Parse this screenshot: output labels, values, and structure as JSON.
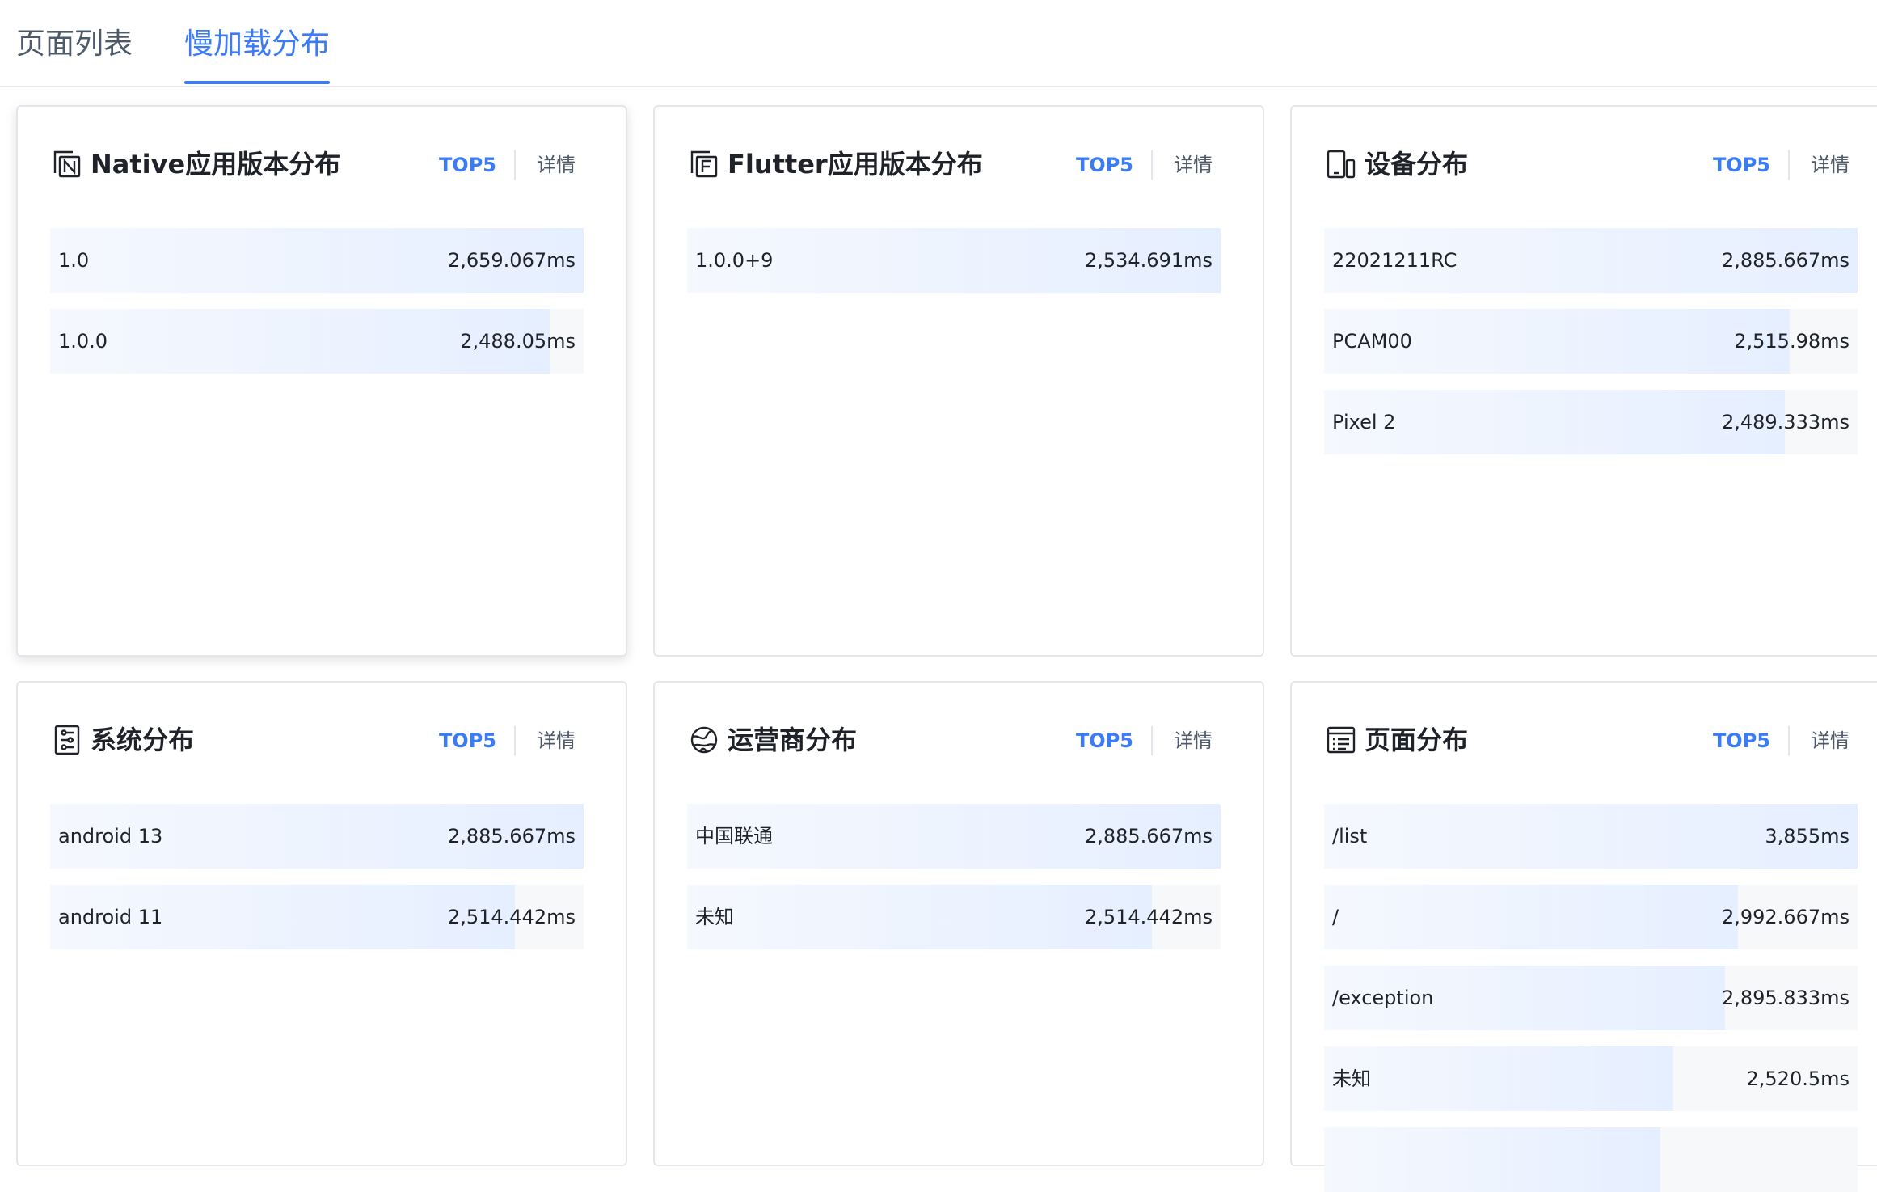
{
  "tabs": [
    {
      "label": "页面列表",
      "active": false
    },
    {
      "label": "慢加载分布",
      "active": true
    }
  ],
  "accent_color": "#3b7bf6",
  "cards": [
    {
      "title": "Native应用版本分布",
      "icon": "native-n-icon",
      "top5_label": "TOP5",
      "detail_label": "详情",
      "rows": [
        {
          "label": "1.0",
          "value": "2,659.067ms",
          "fill": 1.0
        },
        {
          "label": "1.0.0",
          "value": "2,488.05ms",
          "fill": 0.936
        }
      ]
    },
    {
      "title": "Flutter应用版本分布",
      "icon": "flutter-f-icon",
      "top5_label": "TOP5",
      "detail_label": "详情",
      "rows": [
        {
          "label": "1.0.0+9",
          "value": "2,534.691ms",
          "fill": 1.0
        }
      ]
    },
    {
      "title": "设备分布",
      "icon": "device-icon",
      "top5_label": "TOP5",
      "detail_label": "详情",
      "rows": [
        {
          "label": "22021211RC",
          "value": "2,885.667ms",
          "fill": 1.0
        },
        {
          "label": "PCAM00",
          "value": "2,515.98ms",
          "fill": 0.872
        },
        {
          "label": "Pixel 2",
          "value": "2,489.333ms",
          "fill": 0.863
        }
      ]
    },
    {
      "title": "系统分布",
      "icon": "system-settings-icon",
      "top5_label": "TOP5",
      "detail_label": "详情",
      "rows": [
        {
          "label": "android 13",
          "value": "2,885.667ms",
          "fill": 1.0
        },
        {
          "label": "android 11",
          "value": "2,514.442ms",
          "fill": 0.871
        }
      ]
    },
    {
      "title": "运营商分布",
      "icon": "carrier-globe-icon",
      "top5_label": "TOP5",
      "detail_label": "详情",
      "rows": [
        {
          "label": "中国联通",
          "value": "2,885.667ms",
          "fill": 1.0
        },
        {
          "label": "未知",
          "value": "2,514.442ms",
          "fill": 0.871
        }
      ]
    },
    {
      "title": "页面分布",
      "icon": "page-list-icon",
      "top5_label": "TOP5",
      "detail_label": "详情",
      "rows": [
        {
          "label": "/list",
          "value": "3,855ms",
          "fill": 1.0
        },
        {
          "label": "/",
          "value": "2,992.667ms",
          "fill": 0.776
        },
        {
          "label": "/exception",
          "value": "2,895.833ms",
          "fill": 0.751
        },
        {
          "label": "未知",
          "value": "2,520.5ms",
          "fill": 0.654
        },
        {
          "label": "",
          "value": "",
          "fill": 0.63
        }
      ]
    }
  ]
}
